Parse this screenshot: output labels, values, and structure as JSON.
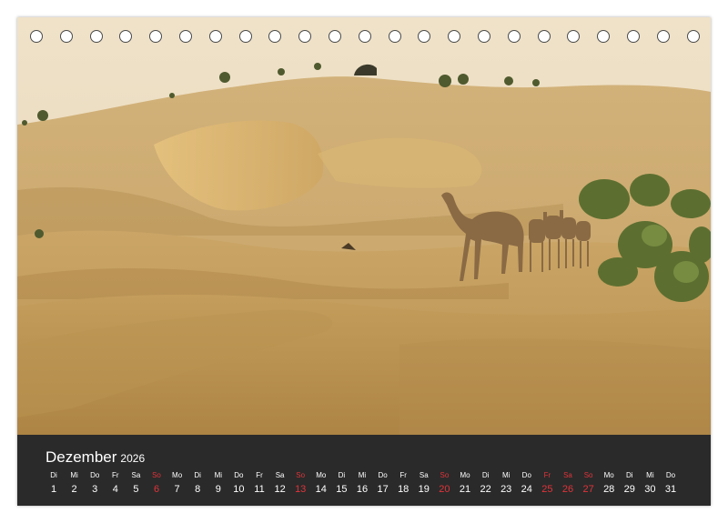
{
  "calendar": {
    "month": "Dezember",
    "year": "2026",
    "days": [
      {
        "wd": "Di",
        "d": "1"
      },
      {
        "wd": "Mi",
        "d": "2"
      },
      {
        "wd": "Do",
        "d": "3"
      },
      {
        "wd": "Fr",
        "d": "4"
      },
      {
        "wd": "Sa",
        "d": "5"
      },
      {
        "wd": "So",
        "d": "6",
        "red": true
      },
      {
        "wd": "Mo",
        "d": "7"
      },
      {
        "wd": "Di",
        "d": "8"
      },
      {
        "wd": "Mi",
        "d": "9"
      },
      {
        "wd": "Do",
        "d": "10"
      },
      {
        "wd": "Fr",
        "d": "11"
      },
      {
        "wd": "Sa",
        "d": "12"
      },
      {
        "wd": "So",
        "d": "13",
        "red": true
      },
      {
        "wd": "Mo",
        "d": "14"
      },
      {
        "wd": "Di",
        "d": "15"
      },
      {
        "wd": "Mi",
        "d": "16"
      },
      {
        "wd": "Do",
        "d": "17"
      },
      {
        "wd": "Fr",
        "d": "18"
      },
      {
        "wd": "Sa",
        "d": "19"
      },
      {
        "wd": "So",
        "d": "20",
        "red": true
      },
      {
        "wd": "Mo",
        "d": "21"
      },
      {
        "wd": "Di",
        "d": "22"
      },
      {
        "wd": "Mi",
        "d": "23"
      },
      {
        "wd": "Do",
        "d": "24"
      },
      {
        "wd": "Fr",
        "d": "25",
        "red": true
      },
      {
        "wd": "Sa",
        "d": "26",
        "red": true
      },
      {
        "wd": "So",
        "d": "27",
        "red": true
      },
      {
        "wd": "Mo",
        "d": "28"
      },
      {
        "wd": "Di",
        "d": "29"
      },
      {
        "wd": "Mi",
        "d": "30"
      },
      {
        "wd": "Do",
        "d": "31"
      }
    ]
  },
  "colors": {
    "holiday": "#e0343a",
    "bar": "#2a2a2a",
    "sand": "#c9a56a",
    "sky": "#e9dcc4"
  },
  "binding": {
    "ring_count": 23
  },
  "photo": {
    "subject": "desert-dunes-camels"
  }
}
